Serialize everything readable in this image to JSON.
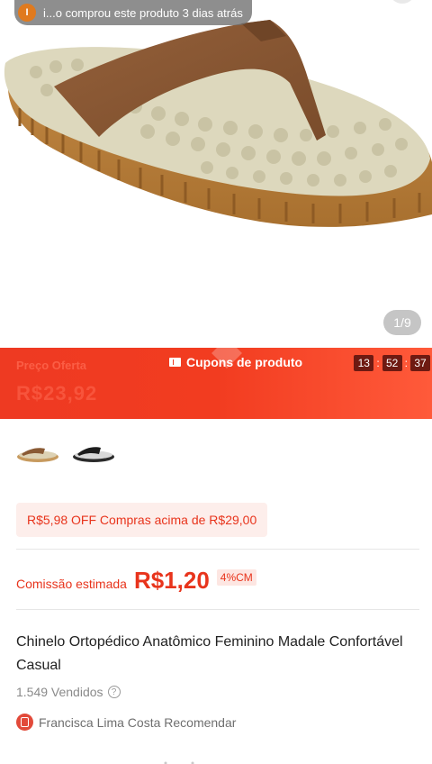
{
  "toast": {
    "avatar_letter": "I",
    "text": "i...o comprou este produto 3 dias atrás"
  },
  "gallery": {
    "counter": "1/9"
  },
  "price_band": {
    "offer_label": "Preço Oferta",
    "offer_price": "R$23,92",
    "coupon_tab": "Cupons de produto",
    "timer": {
      "hours": "13",
      "minutes": "52",
      "seconds": "37"
    }
  },
  "variants": [
    {
      "name": "marrom"
    },
    {
      "name": "preto"
    }
  ],
  "coupon": {
    "text": "R$5,98 OFF Compras acima de R$29,00"
  },
  "commission": {
    "label": "Comissão estimada",
    "value": "R$1,20",
    "rate": "4%CM"
  },
  "product": {
    "title": "Chinelo Ortopédico Anatômico Feminino Madale Confortável Casual",
    "sold": "1.549 Vendidos",
    "help_icon": "?",
    "recommender": "Francisca Lima Costa Recomendar"
  },
  "colors": {
    "brand_red": "#ee3a22",
    "strap_brown": "#8a5a34",
    "sole_beige": "#ddd8bd"
  }
}
